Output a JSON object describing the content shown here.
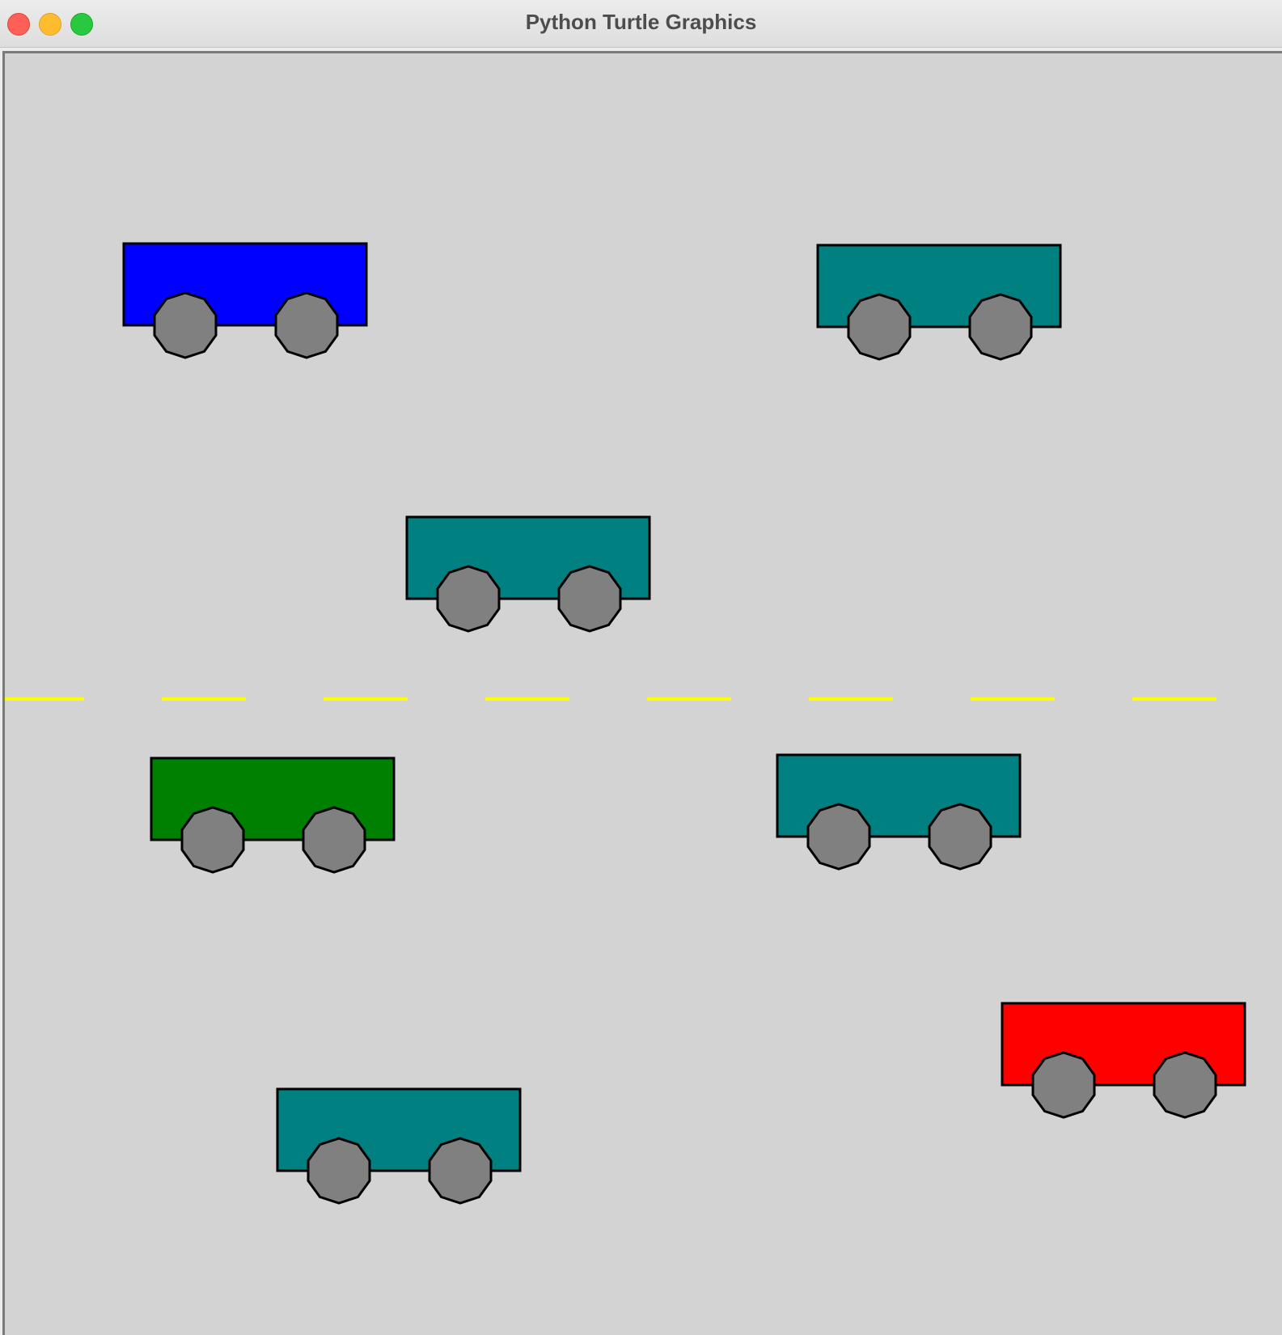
{
  "window": {
    "title": "Python Turtle Graphics"
  },
  "colors": {
    "canvas_background": "#d3d3d3",
    "lane_marking": "#ffff00",
    "wheel": "#808080",
    "outline": "#000000"
  },
  "cars": [
    {
      "name": "car-blue",
      "color": "#0000ff"
    },
    {
      "name": "car-teal-1",
      "color": "#008080"
    },
    {
      "name": "car-teal-2",
      "color": "#008080"
    },
    {
      "name": "car-green",
      "color": "#008000"
    },
    {
      "name": "car-teal-3",
      "color": "#008080"
    },
    {
      "name": "car-red",
      "color": "#ff0000"
    },
    {
      "name": "car-teal-4",
      "color": "#008080"
    }
  ]
}
